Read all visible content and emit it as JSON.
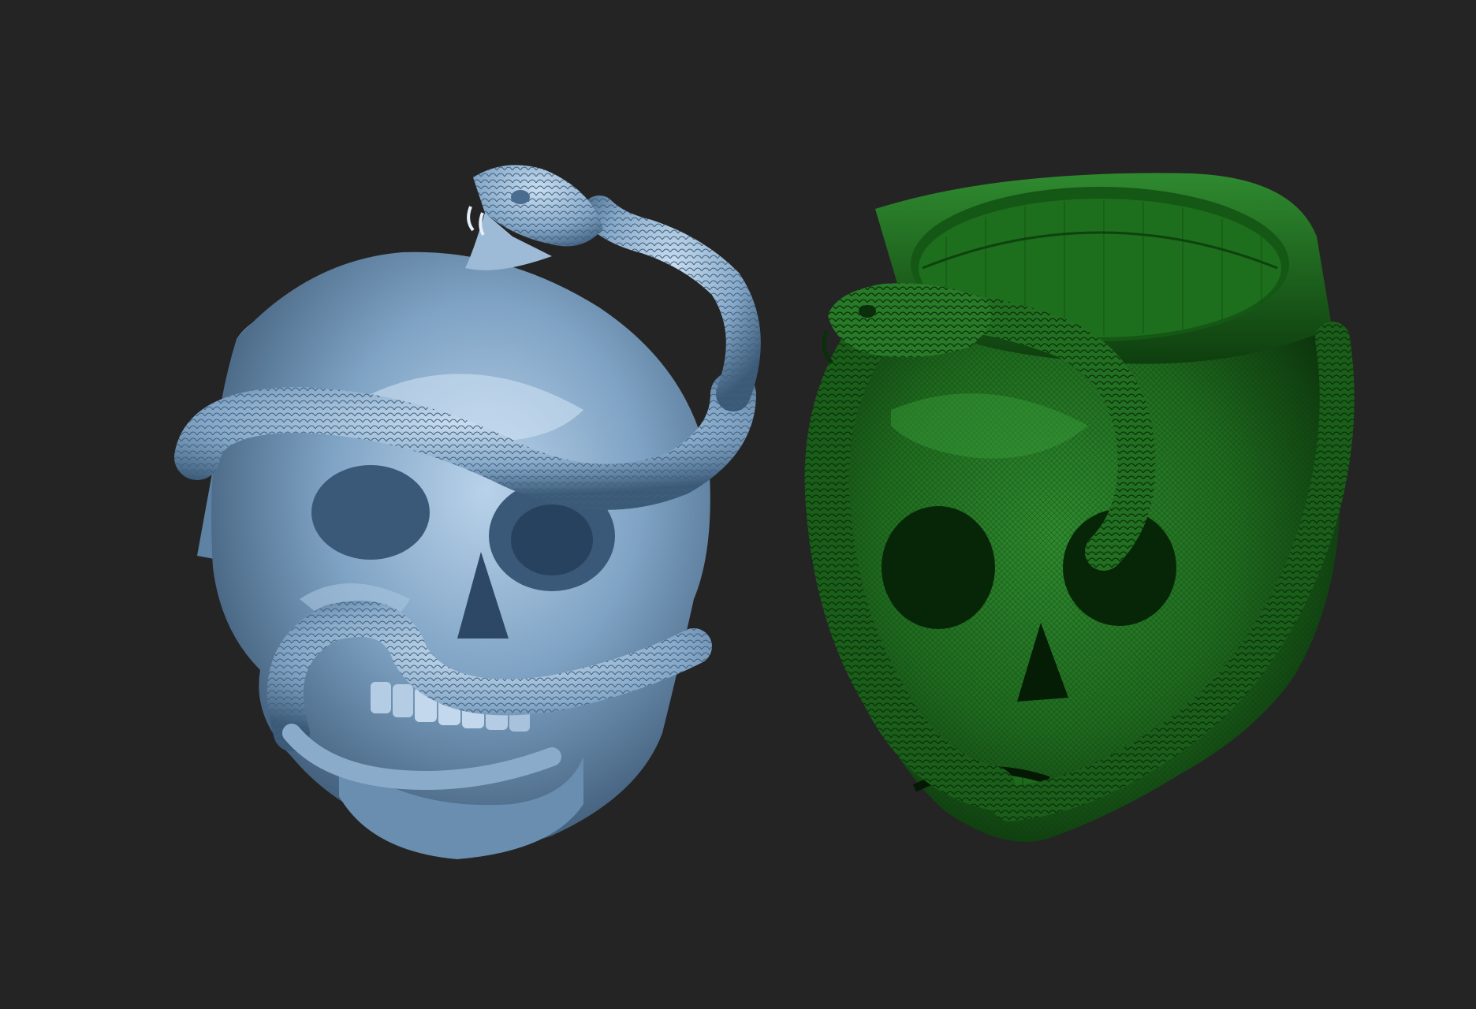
{
  "scene": {
    "background_color": "#242424",
    "models": [
      {
        "id": "skull-ring-shaded",
        "description_icon": "skull-snake-ring",
        "material_color": "#7fa3c4",
        "material_highlight": "#c9def0",
        "material_shadow": "#2f4a66",
        "render_mode": "solid-matcap"
      },
      {
        "id": "skull-ring-wireframe",
        "description_icon": "skull-snake-ring",
        "material_color": "#1f6a1f",
        "material_highlight": "#47b347",
        "material_shadow": "#092809",
        "render_mode": "polyframe"
      }
    ]
  }
}
